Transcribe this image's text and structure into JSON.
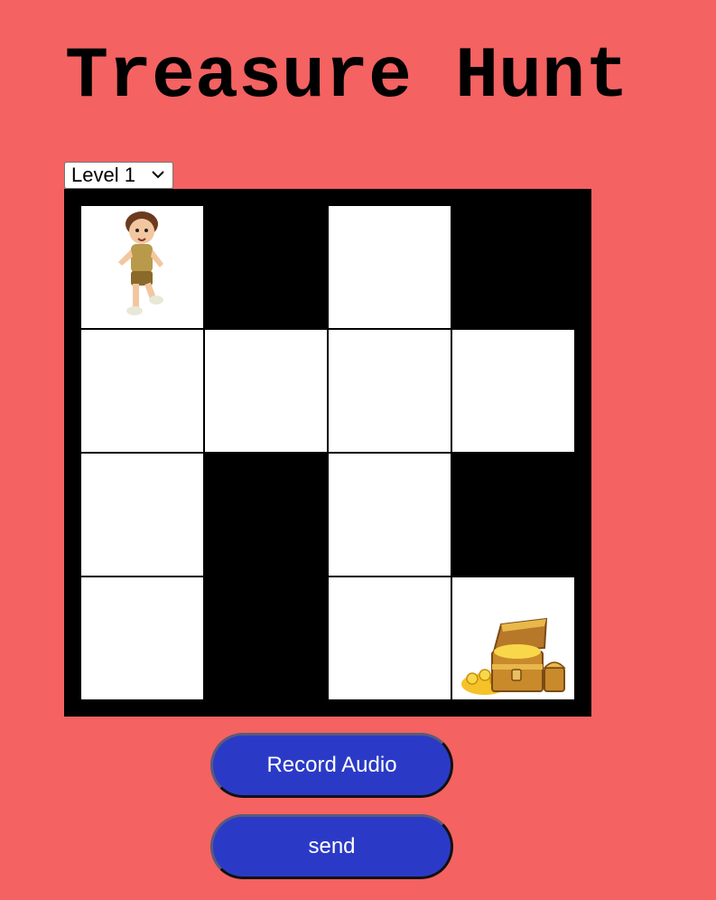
{
  "title": "Treasure Hunt",
  "level_select": {
    "selected": "Level 1",
    "icon": "chevron-down-icon"
  },
  "grid": {
    "rows": 4,
    "cols": 4,
    "cells": [
      [
        "open",
        "wall",
        "open",
        "wall"
      ],
      [
        "open",
        "open",
        "open",
        "open"
      ],
      [
        "open",
        "wall",
        "open",
        "wall"
      ],
      [
        "open",
        "wall",
        "open",
        "open"
      ]
    ],
    "player": {
      "row": 0,
      "col": 0,
      "icon": "explorer-boy-icon"
    },
    "treasure": {
      "row": 3,
      "col": 3,
      "icon": "treasure-chest-icon"
    }
  },
  "buttons": {
    "record_label": "Record Audio",
    "send_label": "send"
  },
  "colors": {
    "background": "#f46262",
    "button": "#2b3ac6",
    "wall": "#000000",
    "open": "#ffffff"
  }
}
